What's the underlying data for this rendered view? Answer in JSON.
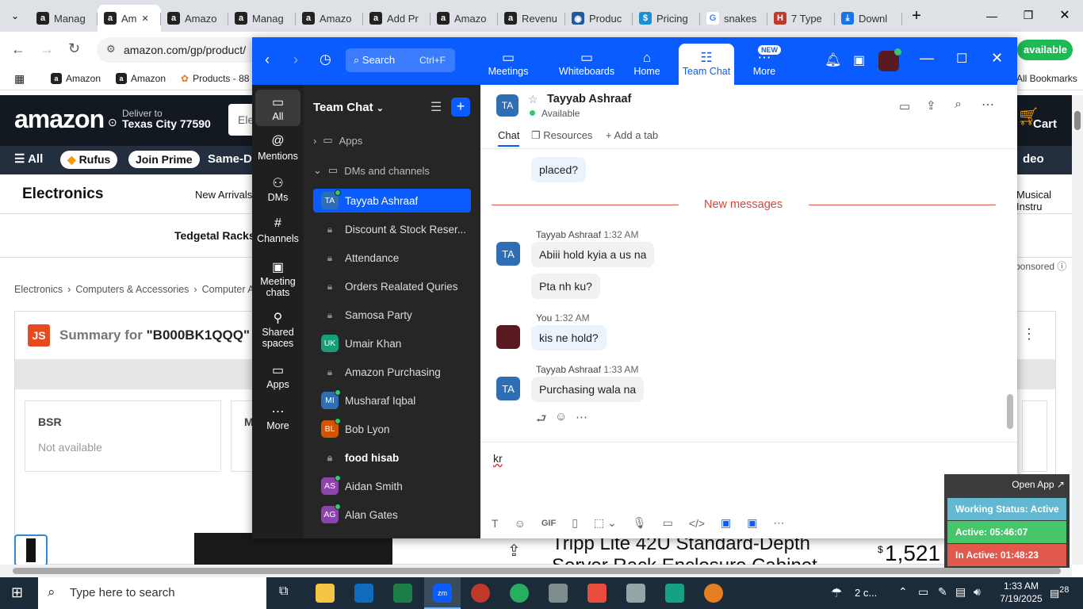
{
  "browser": {
    "tabs": [
      {
        "label": "Manag",
        "icon": "amazon-icon"
      },
      {
        "label": "Am",
        "icon": "amazon-icon",
        "active": true
      },
      {
        "label": "Amazo",
        "icon": "amazon-icon"
      },
      {
        "label": "Manag",
        "icon": "amazon-icon"
      },
      {
        "label": "Amazo",
        "icon": "amazon-icon"
      },
      {
        "label": "Add Pr",
        "icon": "amazon-icon"
      },
      {
        "label": "Amazo",
        "icon": "amazon-icon"
      },
      {
        "label": "Revenu",
        "icon": "amazon-icon"
      },
      {
        "label": "Produc",
        "icon": "globe-icon"
      },
      {
        "label": "Pricing",
        "icon": "dollar-icon"
      },
      {
        "label": "snakes",
        "icon": "google-icon"
      },
      {
        "label": "7 Type",
        "icon": "h2-icon"
      },
      {
        "label": "Downl",
        "icon": "download-icon"
      }
    ],
    "url": "amazon.com/gp/product/",
    "bookmarks": [
      "Amazon",
      "Amazon",
      "Products - 88"
    ],
    "all_bookmarks": "All Bookmarks"
  },
  "amazon": {
    "logo": "amazon",
    "deliver_line1": "Deliver to",
    "deliver_line2": "Texas City 77590",
    "search_text": "Elec",
    "cart": "Cart",
    "nav_all": "All",
    "nav_rufus": "Rufus",
    "nav_prime": "Join Prime",
    "nav_same": "Same-Da",
    "nav_video": "deo",
    "sub_title": "Electronics",
    "sub_new": "New Arrivals",
    "sub_musical": "Musical Instru",
    "tedgetal": "Tedgetal Racks",
    "sponsored": "ponsored",
    "breadcrumb": [
      "Electronics",
      "Computers & Accessories",
      "Computer Acc"
    ],
    "summary_label": "Summary for",
    "summary_asin": "\"B000BK1QQQ\"",
    "js_badge": "JS",
    "bsr_label": "BSR",
    "bsr_value": "Not available",
    "m_label": "M",
    "product_title": "Tripp Lite 42U Standard-Depth",
    "product_title2": "Server Rack Enclosure Cabinet",
    "price": "1,521",
    "price_symbol": "$",
    "available": "available"
  },
  "zoom": {
    "search_placeholder": "Search",
    "search_shortcut": "Ctrl+F",
    "nav": [
      {
        "label": "Meetings",
        "icon": "video-icon"
      },
      {
        "label": "Whiteboards",
        "icon": "whiteboard-icon"
      },
      {
        "label": "Home",
        "icon": "home-icon"
      },
      {
        "label": "Team Chat",
        "icon": "chat-icon",
        "active": true
      },
      {
        "label": "More",
        "icon": "more-icon",
        "badge": "NEW"
      }
    ],
    "rail": [
      {
        "label": "All",
        "icon": "chat-bubble-icon"
      },
      {
        "label": "Mentions",
        "icon": "at-icon"
      },
      {
        "label": "DMs",
        "icon": "people-icon"
      },
      {
        "label": "Channels",
        "icon": "hash-icon"
      },
      {
        "label": "Meeting chats",
        "icon": "calendar-icon"
      },
      {
        "label": "Shared spaces",
        "icon": "shared-icon"
      },
      {
        "label": "Apps",
        "icon": "apps-icon"
      },
      {
        "label": "More",
        "icon": "ellipsis-icon"
      }
    ],
    "list_title": "Team Chat",
    "apps_label": "Apps",
    "dms_label": "DMs and channels",
    "list": [
      {
        "label": "Tayyab Ashraaf",
        "type": "avatar",
        "initials": "TA",
        "color": "#2f6eb5",
        "online": true,
        "selected": true
      },
      {
        "label": "Discount & Stock Reser...",
        "type": "lock"
      },
      {
        "label": "Attendance",
        "type": "lock"
      },
      {
        "label": "Orders Realated Quries",
        "type": "lock"
      },
      {
        "label": "Samosa Party",
        "type": "lock"
      },
      {
        "label": "Umair Khan",
        "type": "avatar",
        "initials": "UK",
        "color": "#1a9e7a",
        "online": false
      },
      {
        "label": "Amazon Purchasing",
        "type": "lock"
      },
      {
        "label": "Musharaf Iqbal",
        "type": "avatar",
        "initials": "MI",
        "color": "#2f6eb5",
        "online": true
      },
      {
        "label": "Bob Lyon",
        "type": "avatar",
        "initials": "BL",
        "color": "#d35400",
        "online": true
      },
      {
        "label": "food hisab",
        "type": "lock",
        "bold": true
      },
      {
        "label": "Aidan Smith",
        "type": "avatar",
        "initials": "AS",
        "color": "#8e44ad",
        "online": true
      },
      {
        "label": "Alan Gates",
        "type": "avatar",
        "initials": "AG",
        "color": "#8e44ad",
        "online": true
      }
    ],
    "chat": {
      "contact_initials": "TA",
      "contact_name": "Tayyab Ashraaf",
      "contact_status": "Available",
      "tabs": [
        "Chat",
        "Resources",
        "Add a tab"
      ],
      "new_messages": "New messages",
      "messages": [
        {
          "text": "placed?"
        },
        {
          "sender": "Tayyab Ashraaf",
          "time": "1:32 AM",
          "text": "Abiii hold kyia a us na"
        },
        {
          "text": "Pta nh ku?"
        },
        {
          "sender": "You",
          "time": "1:32 AM",
          "text": "kis ne hold?"
        },
        {
          "sender": "Tayyab Ashraaf",
          "time": "1:33 AM",
          "text": "Purchasing wala na"
        }
      ],
      "draft": "kr",
      "toolbar_gif": "GIF"
    }
  },
  "widget": {
    "open_app": "Open App ↗",
    "working": "Working Status: Active",
    "active": "Active: 05:46:07",
    "inactive": "In Active: 01:48:23"
  },
  "taskbar": {
    "search_placeholder": "Type here to search",
    "weather": "2 c...",
    "time": "1:33 AM",
    "date": "7/19/2025",
    "notifications": "28"
  }
}
